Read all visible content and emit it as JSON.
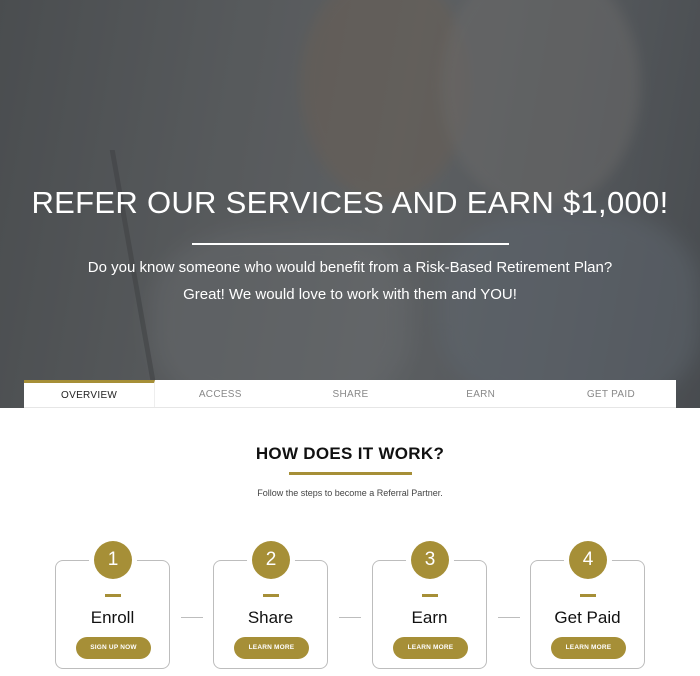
{
  "hero": {
    "title": "REFER OUR SERVICES AND EARN $1,000!",
    "line1": "Do you know someone who would benefit from a Risk-Based Retirement Plan?",
    "line2": "Great! We would love to work with them and YOU!"
  },
  "tabs": [
    {
      "label": "OVERVIEW"
    },
    {
      "label": "ACCESS"
    },
    {
      "label": "SHARE"
    },
    {
      "label": "EARN"
    },
    {
      "label": "GET PAID"
    }
  ],
  "section": {
    "title": "HOW DOES IT WORK?",
    "subtitle": "Follow the steps to become a Referral Partner."
  },
  "steps": [
    {
      "number": "1",
      "label": "Enroll",
      "button": "SIGN UP NOW"
    },
    {
      "number": "2",
      "label": "Share",
      "button": "LEARN MORE"
    },
    {
      "number": "3",
      "label": "Earn",
      "button": "LEARN MORE"
    },
    {
      "number": "4",
      "label": "Get Paid",
      "button": "LEARN MORE"
    }
  ],
  "colors": {
    "accent": "#a68f37",
    "hero_text": "#ffffff",
    "border": "#bdbdbd"
  }
}
